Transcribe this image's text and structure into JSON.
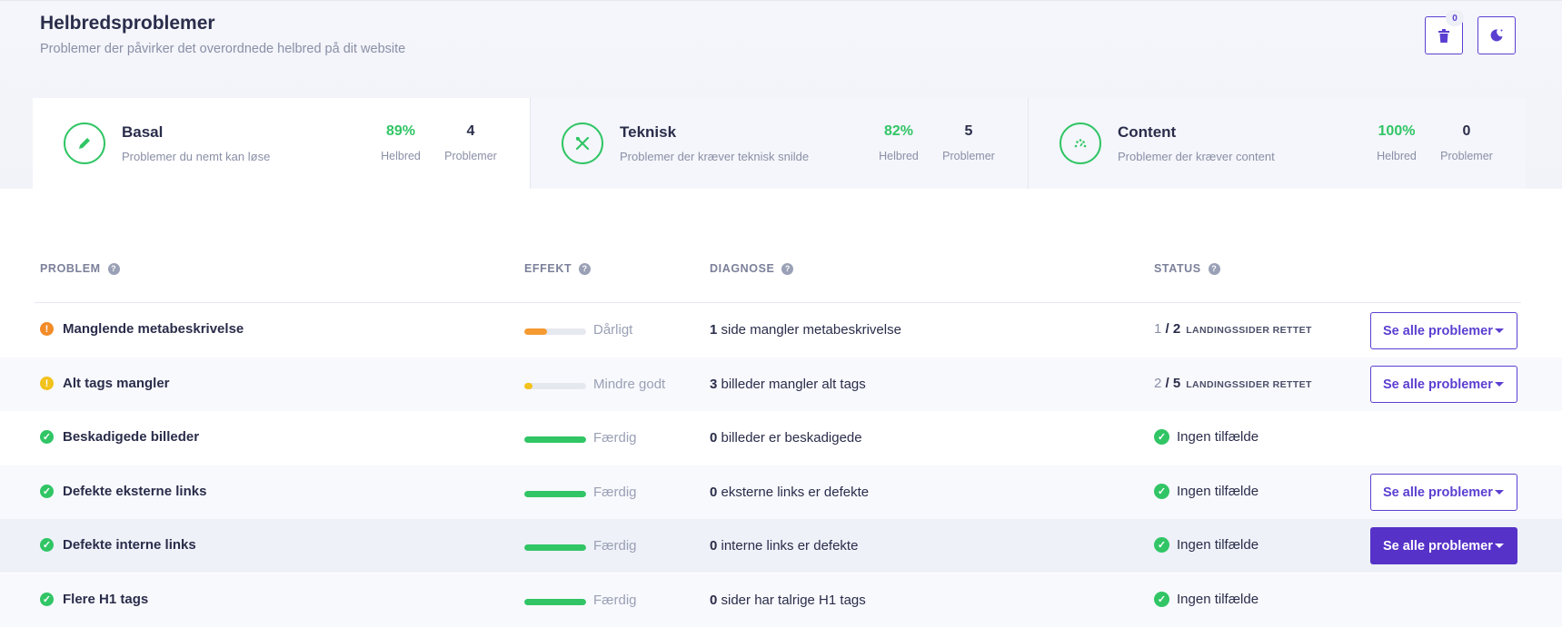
{
  "header": {
    "title": "Helbredsproblemer",
    "subtitle": "Problemer der påvirker det overordnede helbred på dit website",
    "trash_badge": "0"
  },
  "categories": [
    {
      "title": "Basal",
      "subtitle": "Problemer du nemt kan løse",
      "health": "89%",
      "health_label": "Helbred",
      "problems": "4",
      "problems_label": "Problemer",
      "icon": "pencil-icon"
    },
    {
      "title": "Teknisk",
      "subtitle": "Problemer der kræver teknisk snilde",
      "health": "82%",
      "health_label": "Helbred",
      "problems": "5",
      "problems_label": "Problemer",
      "icon": "tools-icon"
    },
    {
      "title": "Content",
      "subtitle": "Problemer der kræver content",
      "health": "100%",
      "health_label": "Helbred",
      "problems": "0",
      "problems_label": "Problemer",
      "icon": "gauge-icon"
    }
  ],
  "table": {
    "headers": {
      "problem": "PROBLEM",
      "effekt": "EFFEKT",
      "diagnose": "DIAGNOSE",
      "status": "STATUS"
    },
    "rows": [
      {
        "severity": "warn",
        "name": "Manglende metabeskrivelse",
        "effect_label": "Dårligt",
        "effect_fill": 0.37,
        "effect_color": "#f59a32",
        "diag_count": "1",
        "diag_text": " side mangler metabeskrivelse",
        "status_fixed": "1",
        "status_sep": " / ",
        "status_total": "2",
        "status_suffix": "LANDINGSSIDER RETTET",
        "button": "Se alle problemer"
      },
      {
        "severity": "minor",
        "name": "Alt tags mangler",
        "effect_label": "Mindre godt",
        "effect_fill": 0.13,
        "effect_color": "#f2c21d",
        "diag_count": "3",
        "diag_text": " billeder mangler alt tags",
        "status_fixed": "2",
        "status_sep": " / ",
        "status_total": "5",
        "status_suffix": "LANDINGSSIDER RETTET",
        "button": "Se alle problemer"
      },
      {
        "severity": "ok",
        "name": "Beskadigede billeder",
        "effect_label": "Færdig",
        "effect_fill": 1.0,
        "effect_color": "#31c565",
        "diag_count": "0",
        "diag_text": " billeder er beskadigede",
        "status_text": "Ingen tilfælde"
      },
      {
        "severity": "ok",
        "name": "Defekte eksterne links",
        "effect_label": "Færdig",
        "effect_fill": 1.0,
        "effect_color": "#31c565",
        "diag_count": "0",
        "diag_text": " eksterne links er defekte",
        "status_text": "Ingen tilfælde",
        "button": "Se alle problemer"
      },
      {
        "severity": "ok",
        "name": "Defekte interne links",
        "effect_label": "Færdig",
        "effect_fill": 1.0,
        "effect_color": "#31c565",
        "diag_count": "0",
        "diag_text": " interne links er defekte",
        "status_text": "Ingen tilfælde",
        "button": "Se alle problemer"
      },
      {
        "severity": "ok",
        "name": "Flere H1 tags",
        "effect_label": "Færdig",
        "effect_fill": 1.0,
        "effect_color": "#31c565",
        "diag_count": "0",
        "diag_text": " sider har talrige H1 tags",
        "status_text": "Ingen tilfælde"
      }
    ]
  },
  "colors": {
    "accent": "#5b3fd1",
    "success": "#31c565",
    "warning": "#f28c28",
    "minor": "#f2c21d"
  }
}
